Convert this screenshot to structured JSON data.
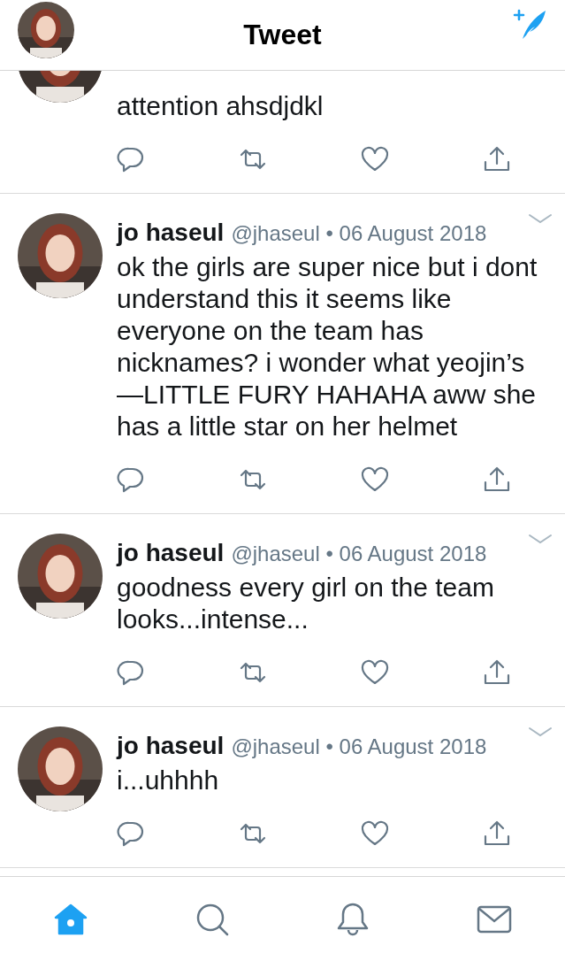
{
  "header": {
    "title": "Tweet"
  },
  "tweets": [
    {
      "text": "attention ahsdjdkl"
    },
    {
      "name": "jo haseul",
      "byline": "@jhaseul • 06 August 2018",
      "text": "ok the girls are super nice but i dont understand this it seems like everyone on the team has nicknames? i wonder what yeojin’s —LITTLE FURY HAHAHA aww she has a little star on her helmet"
    },
    {
      "name": "jo haseul",
      "byline": "@jhaseul • 06 August 2018",
      "text": "goodness every girl on the team looks...intense..."
    },
    {
      "name": "jo haseul",
      "byline": "@jhaseul • 06 August 2018",
      "text": "i...uhhhh"
    }
  ],
  "nav": [
    {
      "kind": "home",
      "selected": true
    },
    {
      "kind": "search",
      "selected": false
    },
    {
      "kind": "notifications",
      "selected": false
    },
    {
      "kind": "messages",
      "selected": false
    }
  ]
}
